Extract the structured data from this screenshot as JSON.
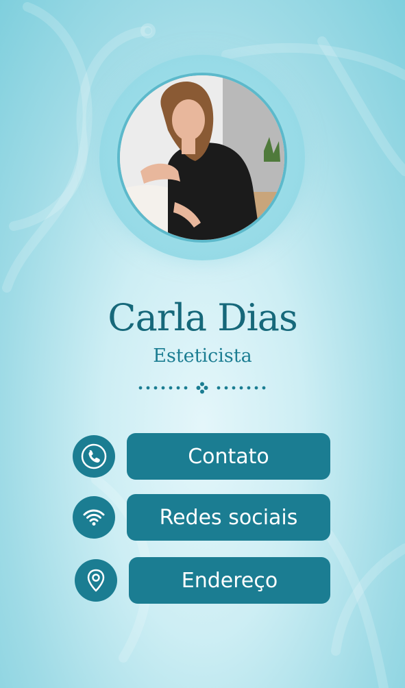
{
  "profile": {
    "name": "Carla Dias",
    "title": "Esteticista"
  },
  "links": [
    {
      "label": "Contato",
      "icon": "phone-icon"
    },
    {
      "label": "Redes sociais",
      "icon": "wifi-icon"
    },
    {
      "label": "Endereço",
      "icon": "location-pin-icon"
    }
  ],
  "colors": {
    "primary": "#1b7d92",
    "name_text": "#16687a",
    "ring": "#a7e2ec",
    "background_light": "#e4f6fa",
    "background_dark": "#7fcfdd"
  }
}
